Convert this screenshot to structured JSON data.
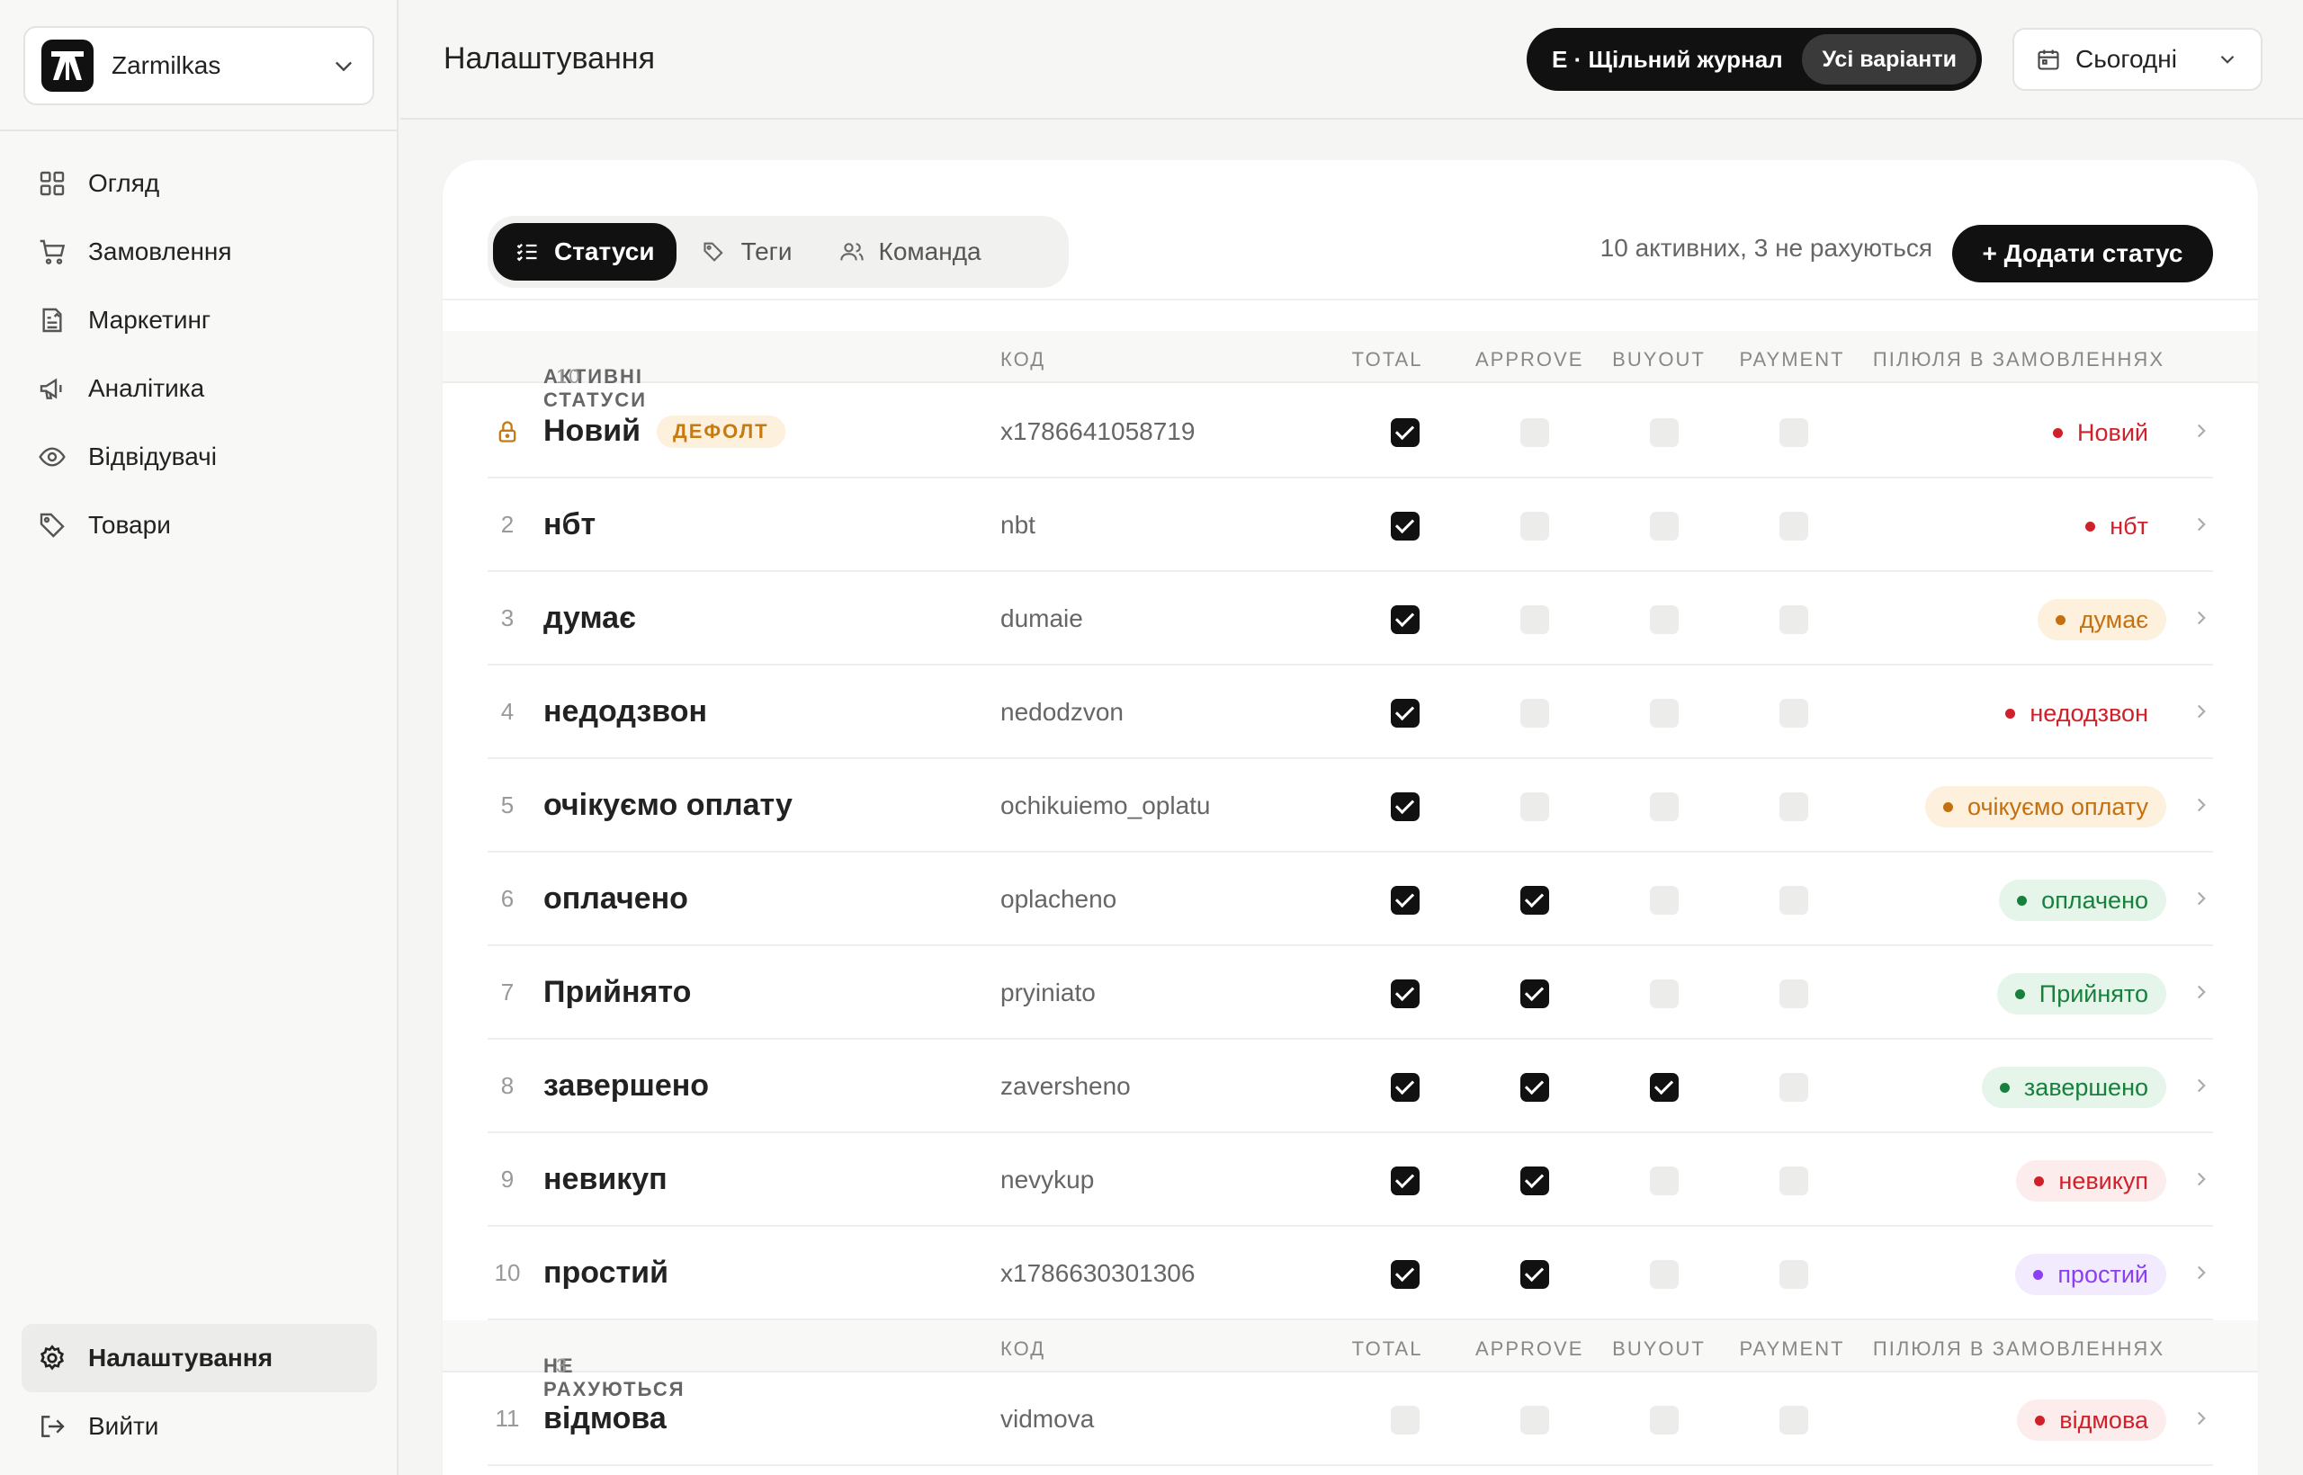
{
  "workspace": {
    "name": "Zarmilkas"
  },
  "nav": {
    "items": [
      {
        "label": "Огляд",
        "icon": "grid-icon"
      },
      {
        "label": "Замовлення",
        "icon": "cart-icon"
      },
      {
        "label": "Маркетинг",
        "icon": "document-icon"
      },
      {
        "label": "Аналітика",
        "icon": "megaphone-icon"
      },
      {
        "label": "Відвідувачі",
        "icon": "eye-icon"
      },
      {
        "label": "Товари",
        "icon": "tag-icon"
      }
    ],
    "settings_label": "Налаштування",
    "logout_label": "Вийти"
  },
  "header": {
    "title": "Налаштування",
    "variant_label": "E · Щільний журнал",
    "variant_button": "Усі варіанти",
    "date_label": "Сьогодні"
  },
  "tabs": [
    {
      "label": "Статуси",
      "active": true
    },
    {
      "label": "Теги",
      "active": false
    },
    {
      "label": "Команда",
      "active": false
    }
  ],
  "summary": "10 активних, 3 не рахуються",
  "add_button": "+ Додати статус",
  "columns": {
    "code": "КОД",
    "total": "TOTAL",
    "approve": "APPROVE",
    "buyout": "BUYOUT",
    "payment": "PAYMENT",
    "pill": "ПІЛЮЛЯ В ЗАМОВЛЕННЯХ"
  },
  "active_section": {
    "title": "АКТИВНІ СТАТУСИ",
    "count": "10"
  },
  "inactive_section": {
    "title": "НЕ РАХУЮТЬСЯ",
    "count": "3"
  },
  "default_badge": "ДЕФОЛТ",
  "colors": {
    "red": {
      "fg": "#d0202a",
      "bg": "#fdecec"
    },
    "orange": {
      "fg": "#c5700e",
      "bg": "#fdf0dd"
    },
    "green": {
      "fg": "#16803c",
      "bg": "#e6f5ea"
    },
    "purple": {
      "fg": "#8a3ff0",
      "bg": "#f2eafd"
    }
  },
  "statuses": [
    {
      "num": "",
      "locked": true,
      "default": true,
      "name": "Новий",
      "code": "x1786641058719",
      "total": true,
      "approve": false,
      "buyout": false,
      "payment": false,
      "pill": "Новий",
      "color": "red",
      "pill_bg": false
    },
    {
      "num": "2",
      "name": "нбт",
      "code": "nbt",
      "total": true,
      "approve": false,
      "buyout": false,
      "payment": false,
      "pill": "нбт",
      "color": "red",
      "pill_bg": false
    },
    {
      "num": "3",
      "name": "думає",
      "code": "dumaie",
      "total": true,
      "approve": false,
      "buyout": false,
      "payment": false,
      "pill": "думає",
      "color": "orange",
      "pill_bg": true
    },
    {
      "num": "4",
      "name": "недодзвон",
      "code": "nedodzvon",
      "total": true,
      "approve": false,
      "buyout": false,
      "payment": false,
      "pill": "недодзвон",
      "color": "red",
      "pill_bg": false
    },
    {
      "num": "5",
      "name": "очікуємо оплату",
      "code": "ochikuiemo_oplatu",
      "total": true,
      "approve": false,
      "buyout": false,
      "payment": false,
      "pill": "очікуємо оплату",
      "color": "orange",
      "pill_bg": true
    },
    {
      "num": "6",
      "name": "оплачено",
      "code": "oplacheno",
      "total": true,
      "approve": true,
      "buyout": false,
      "payment": false,
      "pill": "оплачено",
      "color": "green",
      "pill_bg": true
    },
    {
      "num": "7",
      "name": "Прийнято",
      "code": "pryiniato",
      "total": true,
      "approve": true,
      "buyout": false,
      "payment": false,
      "pill": "Прийнято",
      "color": "green",
      "pill_bg": true
    },
    {
      "num": "8",
      "name": "завершено",
      "code": "zaversheno",
      "total": true,
      "approve": true,
      "buyout": true,
      "payment": false,
      "pill": "завершено",
      "color": "green",
      "pill_bg": true
    },
    {
      "num": "9",
      "name": "невикуп",
      "code": "nevykup",
      "total": true,
      "approve": true,
      "buyout": false,
      "payment": false,
      "pill": "невикуп",
      "color": "red",
      "pill_bg": true
    },
    {
      "num": "10",
      "name": "простий",
      "code": "x1786630301306",
      "total": true,
      "approve": true,
      "buyout": false,
      "payment": false,
      "pill": "простий",
      "color": "purple",
      "pill_bg": true
    }
  ],
  "inactive_statuses": [
    {
      "num": "11",
      "name": "відмова",
      "code": "vidmova",
      "total": false,
      "approve": false,
      "buyout": false,
      "payment": false,
      "pill": "відмова",
      "color": "red",
      "pill_bg": true
    }
  ]
}
